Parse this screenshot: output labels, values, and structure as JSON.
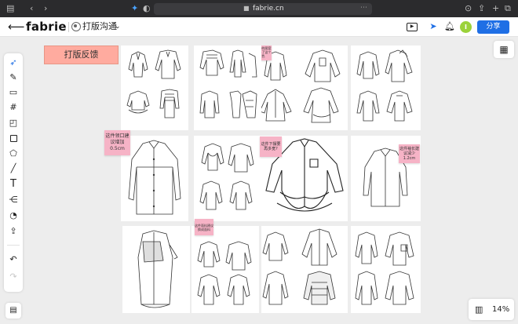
{
  "browser": {
    "url": "fabrie.cn",
    "lock_icon": "lock-icon"
  },
  "header": {
    "back_icon": "arrow-left-icon",
    "brand": "fabrie",
    "doc_title": "打版沟通",
    "share_label": "分享",
    "avatar_initial": "I",
    "avatar_color": "#9bd23a",
    "accent_color": "#1f6fe5"
  },
  "board": {
    "feedback_title": "打版反馈",
    "feedback_color": "#ffab9f",
    "zoom": "14%",
    "notes": {
      "collar": "这件领口建议增加0.5cm",
      "print": "领这种的图案主要弄了这个撞色",
      "hem": "这件下摆要再多宽?",
      "sleeve": "这件袖长建议减少1.2cm",
      "fabric": "这件面料建议换成面料"
    },
    "note_color": "#f6b3c6"
  },
  "toolbar": {
    "tools": [
      "select-icon",
      "pen-icon",
      "frame-icon",
      "grid-icon",
      "sticky-note-icon",
      "rectangle-icon",
      "pentagon-icon",
      "line-icon",
      "text-icon",
      "mindmap-icon",
      "palette-icon",
      "upload-icon"
    ],
    "undo_icon": "undo-icon",
    "redo_icon": "redo-icon"
  }
}
